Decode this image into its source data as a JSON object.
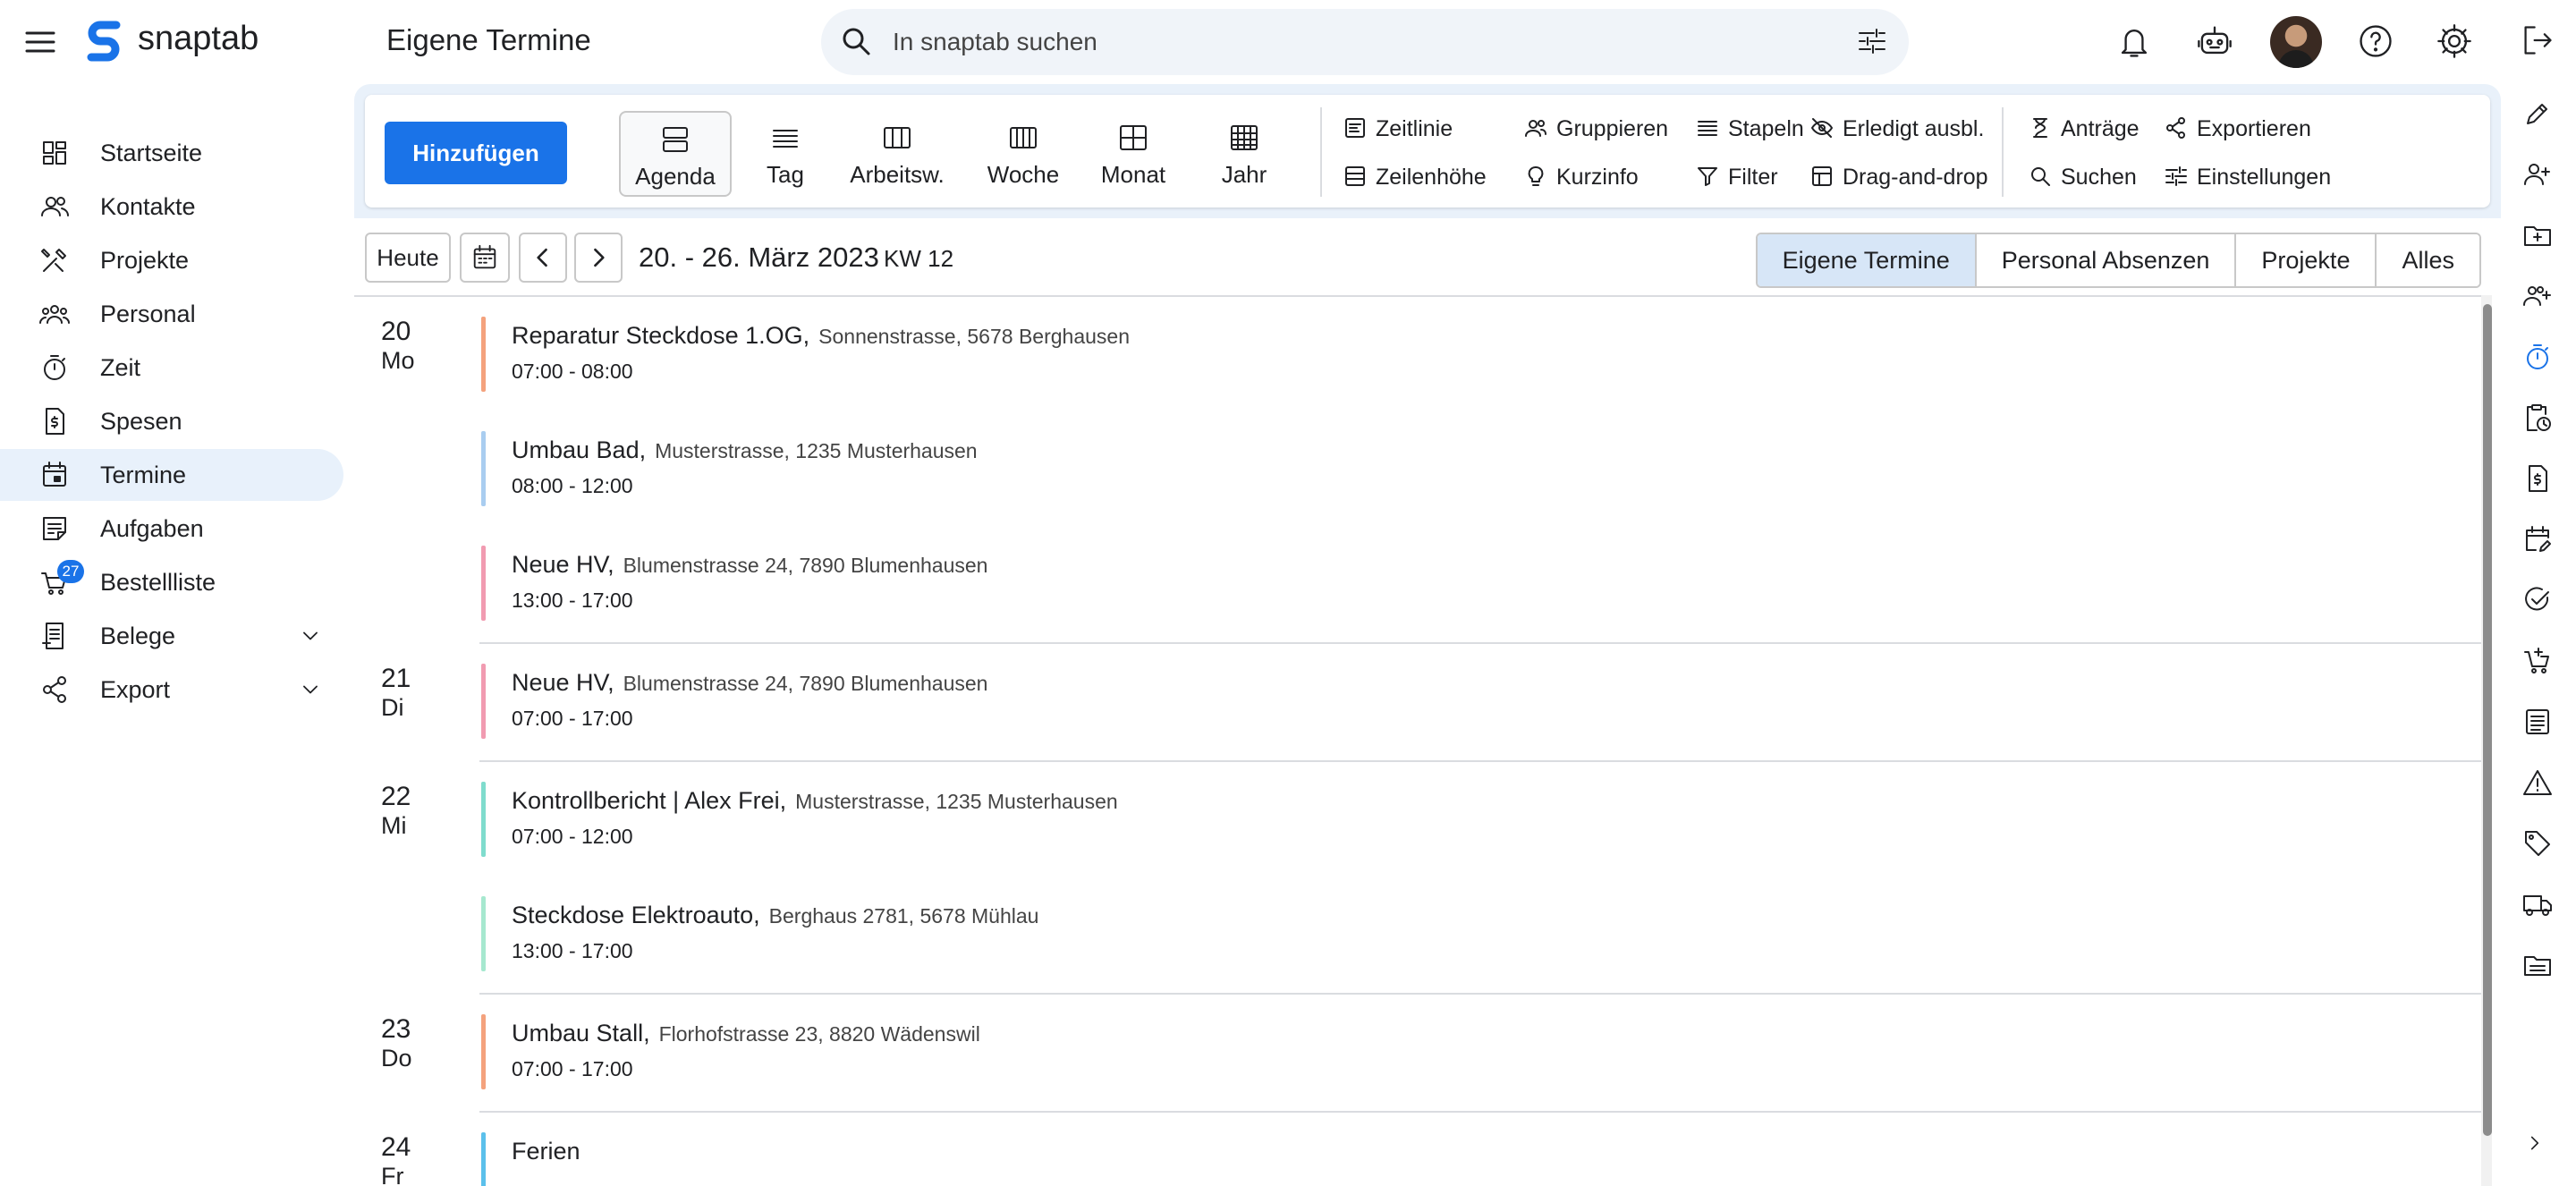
{
  "app": {
    "name": "snaptab",
    "page_title": "Eigene Termine"
  },
  "search": {
    "placeholder": "In snaptab suchen"
  },
  "sidebar": {
    "items": [
      {
        "label": "Startseite"
      },
      {
        "label": "Kontakte"
      },
      {
        "label": "Projekte"
      },
      {
        "label": "Personal"
      },
      {
        "label": "Zeit"
      },
      {
        "label": "Spesen"
      },
      {
        "label": "Termine",
        "active": true
      },
      {
        "label": "Aufgaben"
      },
      {
        "label": "Bestellliste",
        "badge": "27"
      },
      {
        "label": "Belege",
        "expandable": true
      },
      {
        "label": "Export",
        "expandable": true
      }
    ]
  },
  "toolbar": {
    "add_label": "Hinzufügen",
    "views": [
      {
        "label": "Agenda",
        "active": true
      },
      {
        "label": "Tag"
      },
      {
        "label": "Arbeitsw."
      },
      {
        "label": "Woche"
      },
      {
        "label": "Monat"
      },
      {
        "label": "Jahr"
      }
    ],
    "options": [
      {
        "label": "Zeitlinie"
      },
      {
        "label": "Zeilenhöhe"
      },
      {
        "label": "Gruppieren"
      },
      {
        "label": "Kurzinfo"
      },
      {
        "label": "Stapeln"
      },
      {
        "label": "Filter"
      },
      {
        "label": "Erledigt ausbl."
      },
      {
        "label": "Drag-and-drop"
      },
      {
        "label": "Anträge"
      },
      {
        "label": "Suchen"
      },
      {
        "label": "Exportieren"
      },
      {
        "label": "Einstellungen"
      }
    ]
  },
  "navigation": {
    "today_label": "Heute",
    "date_range": "20. - 26. März 2023",
    "week": "KW 12"
  },
  "filters": [
    {
      "label": "Eigene Termine",
      "active": true
    },
    {
      "label": "Personal Absenzen"
    },
    {
      "label": "Projekte"
    },
    {
      "label": "Alles"
    }
  ],
  "colors": {
    "primary": "#1a73e8",
    "active_nav_bg": "#e8f1fb",
    "toolbar_bg": "#e9f1fa"
  },
  "agenda": [
    {
      "day": "20",
      "weekday": "Mo",
      "events": [
        {
          "title": "Reparatur Steckdose 1.OG,",
          "address": "Sonnenstrasse, 5678 Berghausen",
          "time": "07:00 - 08:00",
          "color": "#f4a27d"
        },
        {
          "title": "Umbau Bad,",
          "address": "Musterstrasse, 1235 Musterhausen",
          "time": "08:00 - 12:00",
          "color": "#a9cdf0"
        },
        {
          "title": "Neue HV,",
          "address": "Blumenstrasse 24, 7890 Blumenhausen",
          "time": "13:00 - 17:00",
          "color": "#f19bb1"
        }
      ]
    },
    {
      "day": "21",
      "weekday": "Di",
      "events": [
        {
          "title": "Neue HV,",
          "address": "Blumenstrasse 24, 7890 Blumenhausen",
          "time": "07:00 - 17:00",
          "color": "#f19bb1"
        }
      ]
    },
    {
      "day": "22",
      "weekday": "Mi",
      "events": [
        {
          "title": "Kontrollbericht | Alex Frei,",
          "address": "Musterstrasse, 1235 Musterhausen",
          "time": "07:00 - 12:00",
          "color": "#7fdccd"
        },
        {
          "title": "Steckdose Elektroauto,",
          "address": "Berghaus 2781, 5678 Mühlau",
          "time": "13:00 - 17:00",
          "color": "#a6e8cf"
        }
      ]
    },
    {
      "day": "23",
      "weekday": "Do",
      "events": [
        {
          "title": "Umbau Stall,",
          "address": "Florhofstrasse 23, 8820 Wädenswil",
          "time": "07:00 - 17:00",
          "color": "#f4a27d"
        }
      ]
    },
    {
      "day": "24",
      "weekday": "Fr",
      "events": [
        {
          "title": "Ferien",
          "address": "",
          "time": "",
          "color": "#5bc0eb"
        }
      ]
    }
  ]
}
